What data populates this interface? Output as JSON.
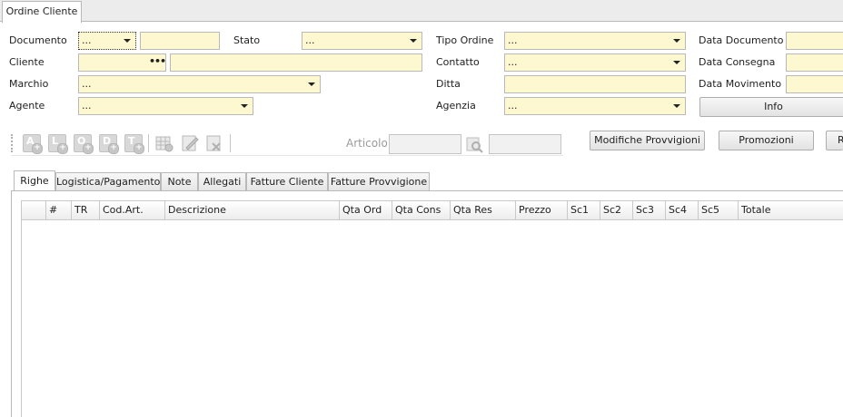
{
  "window_tab": "Ordine Cliente",
  "form": {
    "documento": {
      "label": "Documento",
      "value": "...",
      "number": ""
    },
    "stato": {
      "label": "Stato",
      "value": "..."
    },
    "tipo_ordine": {
      "label": "Tipo Ordine",
      "value": "..."
    },
    "data_documento": {
      "label": "Data Documento",
      "value": ""
    },
    "cliente": {
      "label": "Cliente",
      "code": "",
      "dots": "•••",
      "name": ""
    },
    "contatto": {
      "label": "Contatto",
      "value": "..."
    },
    "data_consegna": {
      "label": "Data Consegna",
      "value": ""
    },
    "marchio": {
      "label": "Marchio",
      "value": "..."
    },
    "ditta": {
      "label": "Ditta",
      "value": ""
    },
    "data_movimento": {
      "label": "Data Movimento",
      "value": ""
    },
    "agente": {
      "label": "Agente",
      "value": "..."
    },
    "agenzia": {
      "label": "Agenzia",
      "value": "..."
    }
  },
  "buttons": {
    "info": "Info",
    "modifiche_provvigioni": "Modifiche Provvigioni",
    "promozioni": "Promozioni",
    "r": "R"
  },
  "toolbar": {
    "icons": [
      "A",
      "L",
      "O",
      "D",
      "T"
    ],
    "articolo_label": "Articolo",
    "articolo_value": "",
    "articolo_value2": ""
  },
  "tabs": [
    "Righe",
    "Logistica/Pagamento",
    "Note",
    "Allegati",
    "Fatture Cliente",
    "Fatture Provvigione"
  ],
  "grid": {
    "columns": [
      "",
      "#",
      "TR",
      "Cod.Art.",
      "Descrizione",
      "Qta Ord",
      "Qta Cons",
      "Qta Res",
      "Prezzo",
      "Sc1",
      "Sc2",
      "Sc3",
      "Sc4",
      "Sc5",
      "Totale"
    ],
    "rows": []
  }
}
